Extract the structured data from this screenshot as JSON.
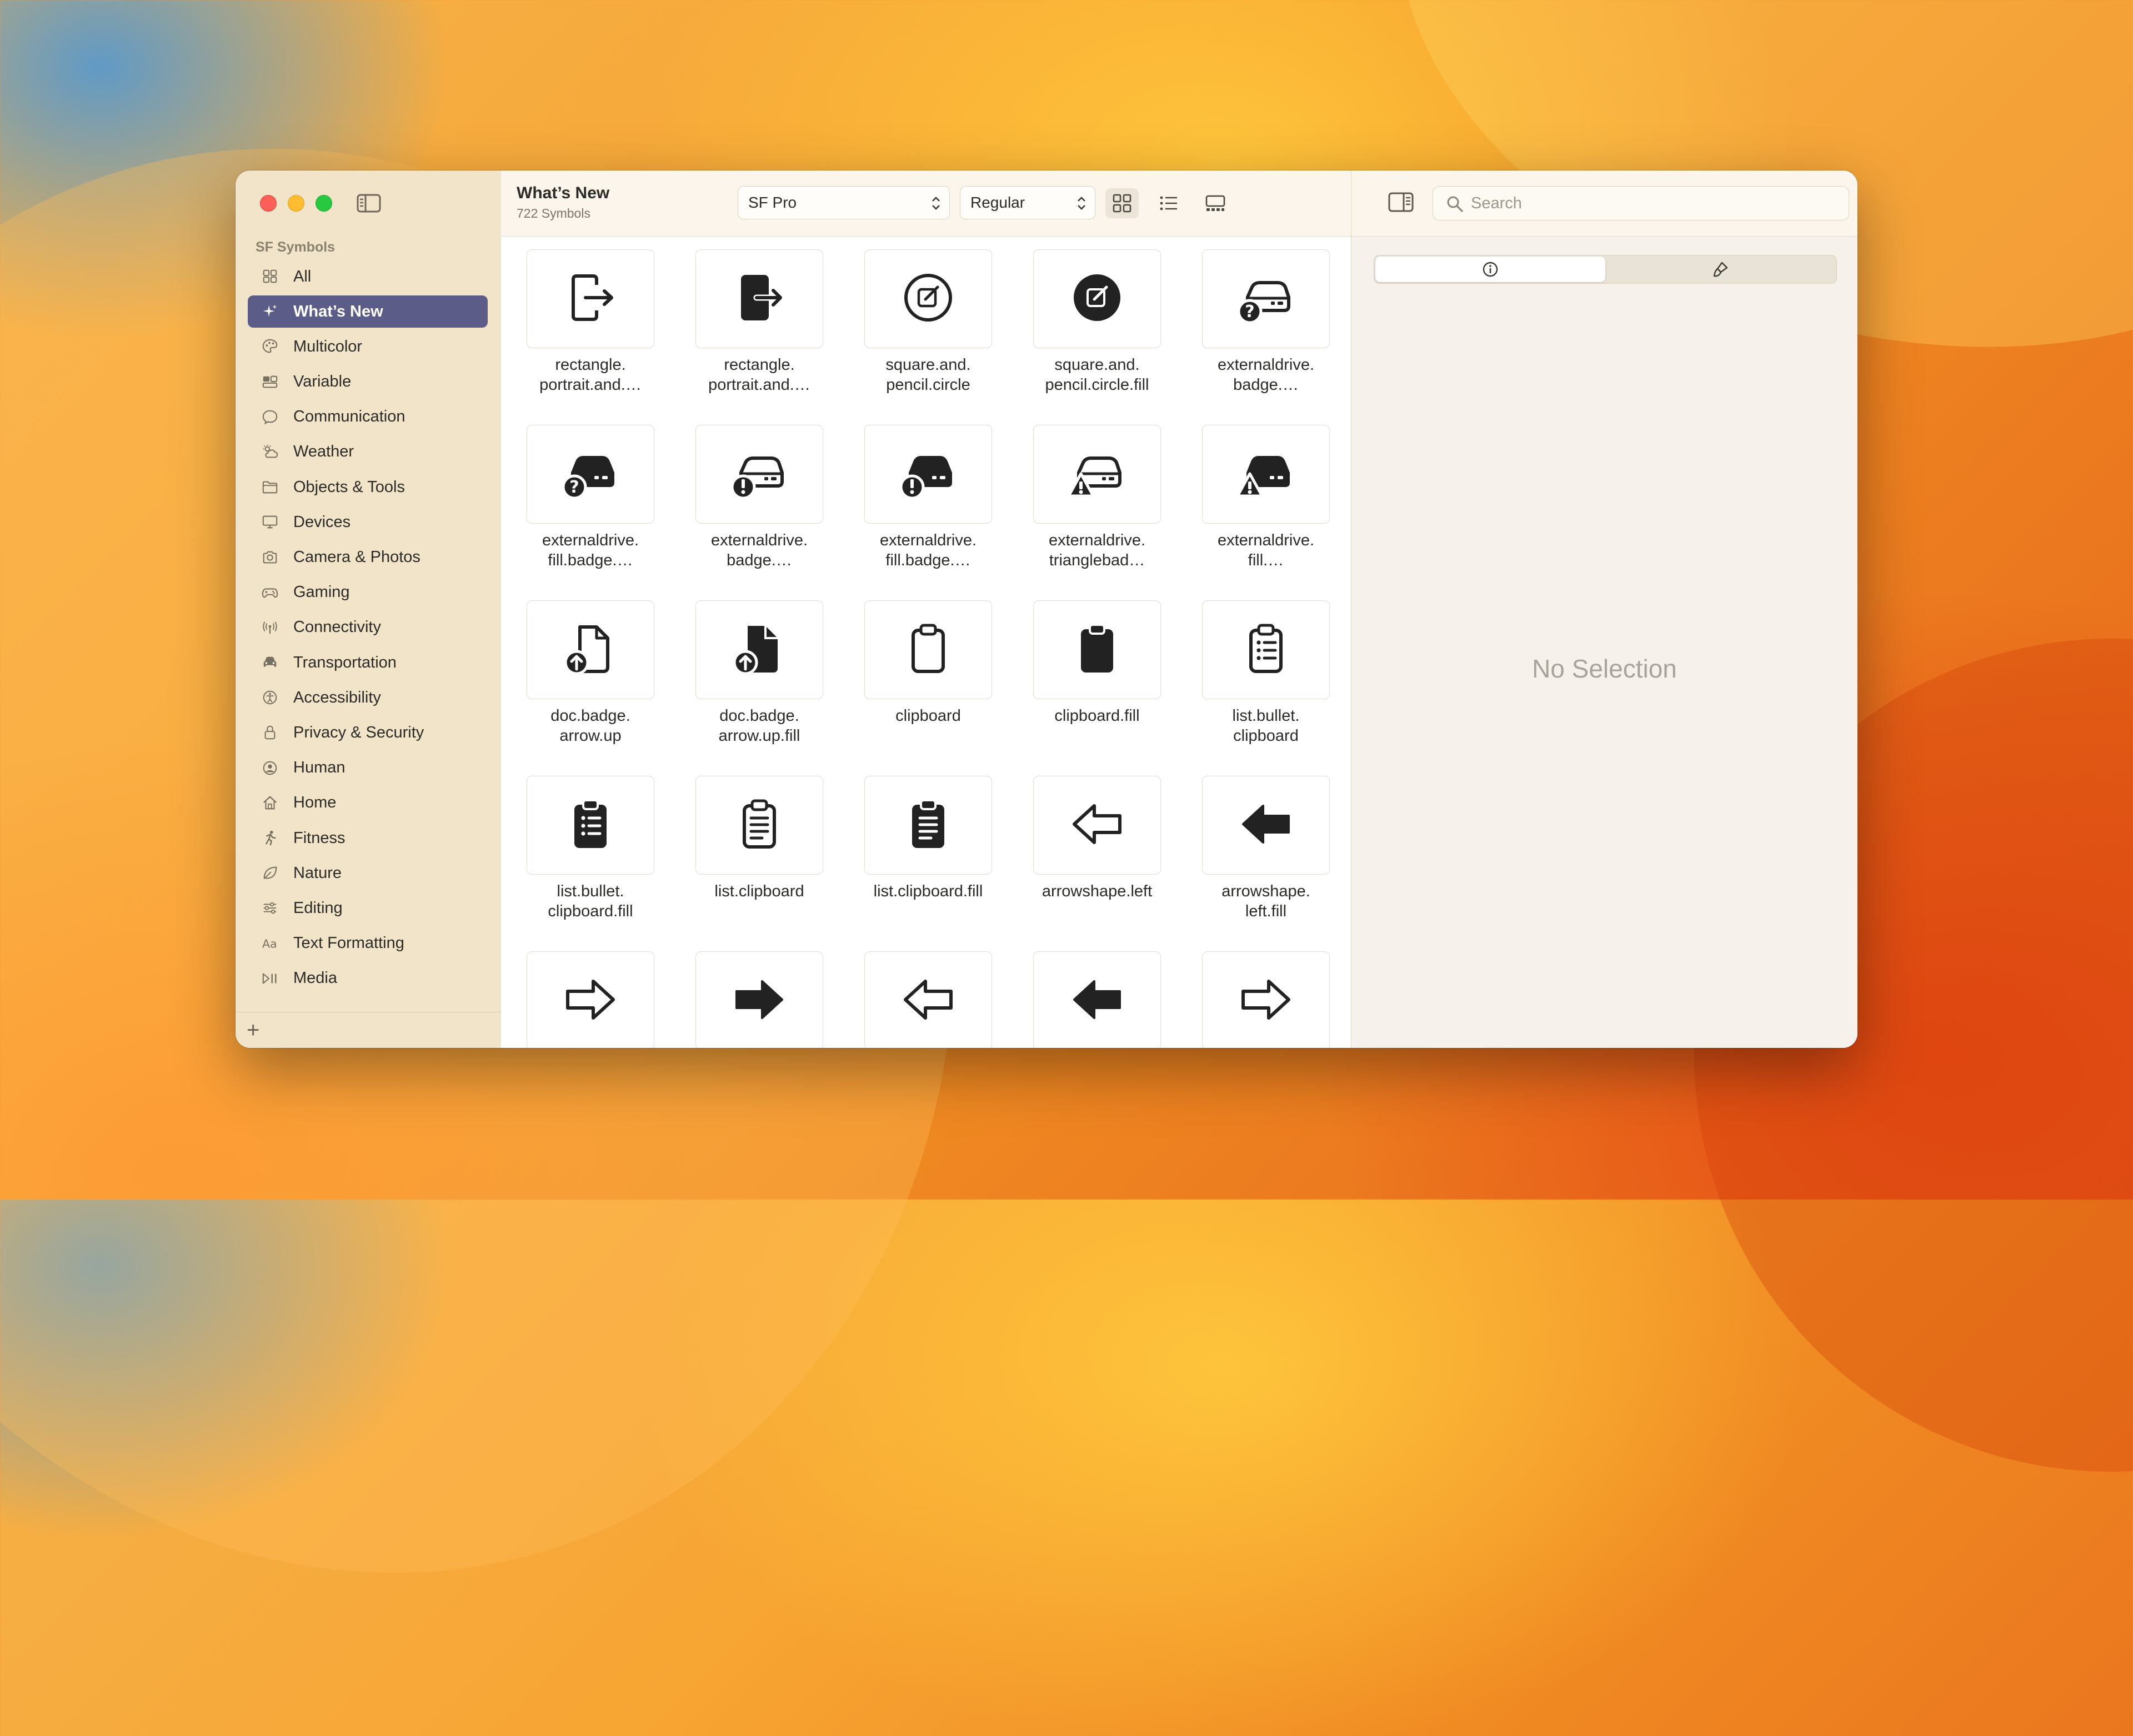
{
  "app": {
    "sidebar_section": "SF Symbols",
    "sidebar_items": [
      {
        "label": "All",
        "icon": "grid-icon"
      },
      {
        "label": "What’s New",
        "icon": "sparkle-icon"
      },
      {
        "label": "Multicolor",
        "icon": "palette-icon"
      },
      {
        "label": "Variable",
        "icon": "variable-icon"
      },
      {
        "label": "Communication",
        "icon": "bubble-icon"
      },
      {
        "label": "Weather",
        "icon": "cloud-sun-icon"
      },
      {
        "label": "Objects & Tools",
        "icon": "folder-icon"
      },
      {
        "label": "Devices",
        "icon": "display-icon"
      },
      {
        "label": "Camera & Photos",
        "icon": "camera-icon"
      },
      {
        "label": "Gaming",
        "icon": "gamecontroller-icon"
      },
      {
        "label": "Connectivity",
        "icon": "antenna-icon"
      },
      {
        "label": "Transportation",
        "icon": "car-icon"
      },
      {
        "label": "Accessibility",
        "icon": "accessibility-icon"
      },
      {
        "label": "Privacy & Security",
        "icon": "lock-icon"
      },
      {
        "label": "Human",
        "icon": "person-circle-icon"
      },
      {
        "label": "Home",
        "icon": "house-icon"
      },
      {
        "label": "Fitness",
        "icon": "figure-run-icon"
      },
      {
        "label": "Nature",
        "icon": "leaf-icon"
      },
      {
        "label": "Editing",
        "icon": "sliders-icon"
      },
      {
        "label": "Text Formatting",
        "icon": "textformat-icon"
      },
      {
        "label": "Media",
        "icon": "playpause-icon"
      }
    ],
    "selected_index": 1
  },
  "toolbar": {
    "title": "What’s New",
    "subtitle": "722 Symbols",
    "font_popup": "SF Pro",
    "weight_popup": "Regular",
    "view_modes": [
      "grid-view",
      "list-view",
      "gallery-view"
    ],
    "active_view": "grid-view"
  },
  "symbols": [
    {
      "label": "rectangle.\nportrait.and.…",
      "icon": "rect-arrow-icon"
    },
    {
      "label": "rectangle.\nportrait.and.…",
      "icon": "rect-arrow-fill-icon"
    },
    {
      "label": "square.and.\npencil.circle",
      "icon": "pencil-circle-icon"
    },
    {
      "label": "square.and.\npencil.circle.fill",
      "icon": "pencil-circle-fill-icon"
    },
    {
      "label": "externaldrive.\nbadge.…",
      "icon": "drive-question-icon"
    },
    {
      "label": "externaldrive.\nfill.badge.…",
      "icon": "drive-fill-question-icon"
    },
    {
      "label": "externaldrive.\nbadge.…",
      "icon": "drive-exclaim-icon"
    },
    {
      "label": "externaldrive.\nfill.badge.…",
      "icon": "drive-fill-exclaim-icon"
    },
    {
      "label": "externaldrive.\ntrianglebad…",
      "icon": "drive-triangle-icon"
    },
    {
      "label": "externaldrive.\nfill.…",
      "icon": "drive-fill-triangle-icon"
    },
    {
      "label": "doc.badge.\narrow.up",
      "icon": "doc-arrow-up-icon"
    },
    {
      "label": "doc.badge.\narrow.up.fill",
      "icon": "doc-arrow-up-fill-icon"
    },
    {
      "label": "clipboard",
      "icon": "clipboard-icon"
    },
    {
      "label": "clipboard.fill",
      "icon": "clipboard-fill-icon"
    },
    {
      "label": "list.bullet.\nclipboard",
      "icon": "list-bullet-clipboard-icon"
    },
    {
      "label": "list.bullet.\nclipboard.fill",
      "icon": "list-bullet-clipboard-fill-icon"
    },
    {
      "label": "list.clipboard",
      "icon": "list-clipboard-icon"
    },
    {
      "label": "list.clipboard.fill",
      "icon": "list-clipboard-fill-icon"
    },
    {
      "label": "arrowshape.left",
      "icon": "arrowshape-left-icon"
    },
    {
      "label": "arrowshape.\nleft.fill",
      "icon": "arrowshape-left-fill-icon"
    },
    {
      "label": "",
      "icon": "arrowshape-right-icon"
    },
    {
      "label": "",
      "icon": "arrowshape-right-fill-icon"
    },
    {
      "label": "",
      "icon": "arrowshape-left-icon"
    },
    {
      "label": "",
      "icon": "arrowshape-left-fill-icon"
    },
    {
      "label": "",
      "icon": "arrowshape-right-icon"
    }
  ],
  "inspector": {
    "search_placeholder": "Search",
    "segments": [
      "info-icon",
      "paintbrush-icon"
    ],
    "empty_text": "No Selection"
  }
}
